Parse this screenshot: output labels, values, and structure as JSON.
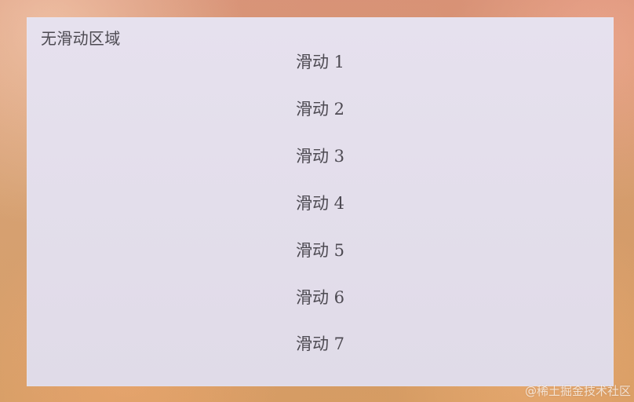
{
  "panel": {
    "fixed_label": "无滑动区域",
    "items": [
      "滑动 1",
      "滑动 2",
      "滑动 3",
      "滑动 4",
      "滑动 5",
      "滑动 6",
      "滑动 7"
    ]
  },
  "watermark": "@稀土掘金技术社区",
  "colors": {
    "panel_background": "#e3deea",
    "text": "#4d4a52",
    "watermark": "#ffffff"
  }
}
